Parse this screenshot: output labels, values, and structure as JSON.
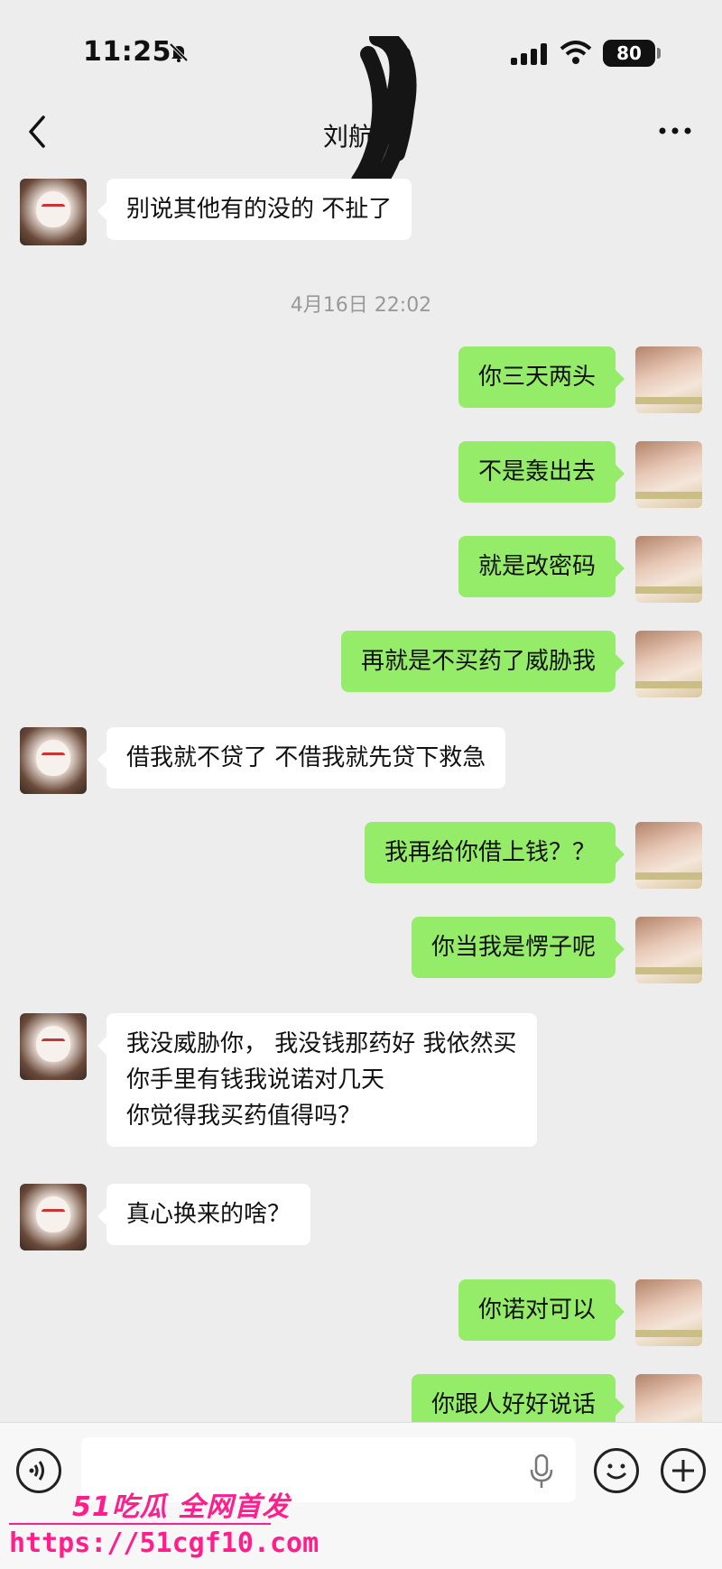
{
  "status": {
    "time": "11:25",
    "battery": "80"
  },
  "header": {
    "title": "刘航汝"
  },
  "timestamp": "4月16日 22:02",
  "messages": [
    {
      "side": "in",
      "text": "别说其他有的没的 不扯了"
    },
    {
      "side": "out",
      "text": "你三天两头"
    },
    {
      "side": "out",
      "text": "不是轰出去"
    },
    {
      "side": "out",
      "text": "就是改密码"
    },
    {
      "side": "out",
      "text": "再就是不买药了威胁我"
    },
    {
      "side": "in",
      "text": "借我就不贷了 不借我就先贷下救急"
    },
    {
      "side": "out",
      "text": "我再给你借上钱？？"
    },
    {
      "side": "out",
      "text": "你当我是愣子呢"
    },
    {
      "side": "in",
      "text": "我没威胁你， 我没钱那药好 我依然买\n你手里有钱我说诺对几天\n你觉得我买药值得吗？"
    },
    {
      "side": "in",
      "text": "真心换来的啥？"
    },
    {
      "side": "out",
      "text": "你诺对可以"
    },
    {
      "side": "out",
      "text": "你跟人好好说话"
    }
  ],
  "input": {
    "placeholder": ""
  },
  "watermark": {
    "brand": "51吃瓜 全网首发",
    "url": "https://51cgf10.com"
  },
  "colors": {
    "outgoing_bubble": "#95ec69",
    "incoming_bubble": "#ffffff",
    "background": "#ededed",
    "watermark": "#ff1e8c"
  },
  "icons": [
    "bell-slash-icon",
    "signal-icon",
    "wifi-icon",
    "battery-icon",
    "back-chevron-icon",
    "more-dots-icon",
    "voice-icon",
    "microphone-icon",
    "emoji-icon",
    "plus-icon"
  ]
}
